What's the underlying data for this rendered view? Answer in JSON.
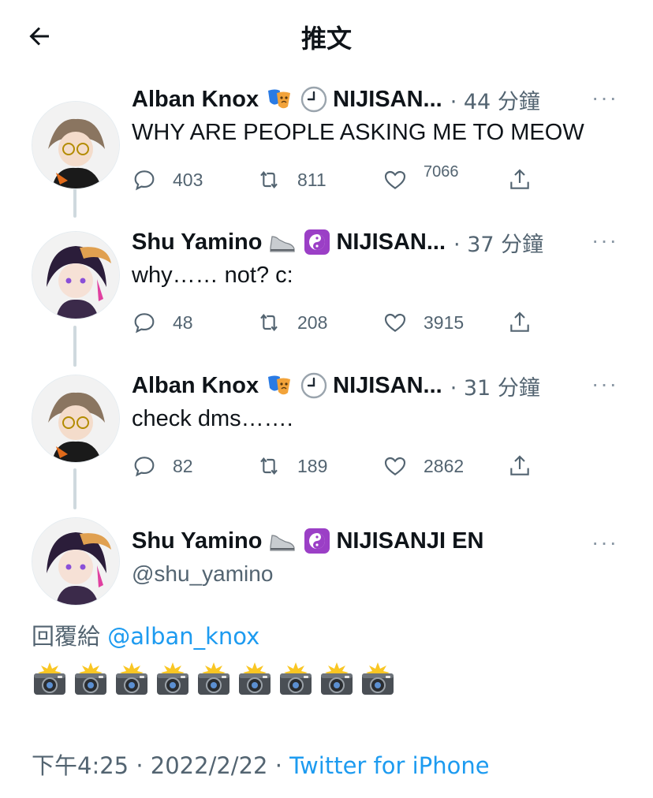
{
  "header": {
    "title": "推文"
  },
  "thread": [
    {
      "name": "Alban Knox",
      "emojis": [
        "masks-emoji",
        "clock-emoji"
      ],
      "org": "NIJISAN...",
      "time": "· 44 分鐘",
      "text": "WHY ARE PEOPLE ASKING ME TO MEOW",
      "replies": "403",
      "retweets": "811",
      "likes": "7066"
    },
    {
      "name": "Shu Yamino",
      "emojis": [
        "shoe-emoji",
        "yin-yang-emoji"
      ],
      "org": "NIJISAN...",
      "time": "· 37 分鐘",
      "text": "why…… not? c:",
      "replies": "48",
      "retweets": "208",
      "likes": "3915"
    },
    {
      "name": "Alban Knox",
      "emojis": [
        "masks-emoji",
        "clock-emoji"
      ],
      "org": "NIJISAN...",
      "time": "· 31 分鐘",
      "text": "check dms…….",
      "replies": "82",
      "retweets": "189",
      "likes": "2862"
    }
  ],
  "main_tweet": {
    "name": "Shu Yamino",
    "org": "NIJISANJI EN",
    "handle": "@shu_yamino",
    "reply_prefix": "回覆給",
    "reply_to": "@alban_knox",
    "camera_count": 9,
    "time": "下午4:25 · 2022/2/22 · ",
    "source": "Twitter for iPhone"
  },
  "colors": {
    "accent": "#1d9bf0",
    "muted": "#536471",
    "thread_line": "#cfd9de"
  }
}
